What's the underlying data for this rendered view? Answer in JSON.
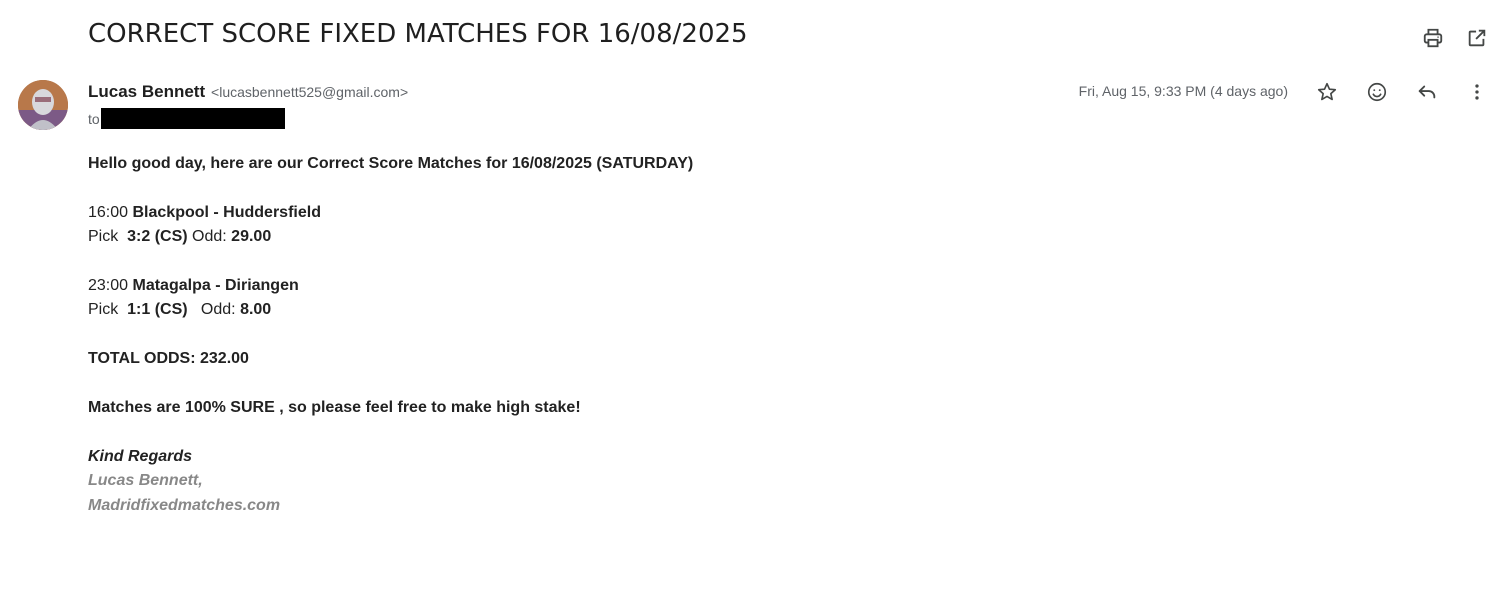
{
  "subject": "CORRECT SCORE FIXED MATCHES FOR 16/08/2025",
  "sender": {
    "name": "Lucas Bennett",
    "email": "<lucasbennett525@gmail.com>"
  },
  "to_label": "to",
  "date": "Fri, Aug 15, 9:33 PM (4 days ago)",
  "icons": {
    "print": "printer-icon",
    "open_new": "open-in-new-window-icon",
    "star": "star-icon",
    "emoji": "emoji-reaction-icon",
    "reply": "reply-icon",
    "more": "more-vert-icon"
  },
  "body": {
    "greeting": "Hello good day, here are our Correct Score Matches for 16/08/2025 (SATURDAY)",
    "match1": {
      "time": "16:00",
      "teams": "Blackpool - Huddersfield",
      "pick_label": "Pick",
      "pick": "3:2 (CS)",
      "odd_label": "Odd:",
      "odd": "29.00"
    },
    "match2": {
      "time": "23:00",
      "teams": "Matagalpa - Diriangen",
      "pick_label": "Pick",
      "pick": "1:1 (CS)",
      "odd_label": "Odd:",
      "odd": "8.00"
    },
    "total": "TOTAL ODDS: 232.00",
    "note": "Matches are 100% SURE , so please feel free to make high stake!",
    "regards": "Kind Regards",
    "sig_name": "Lucas Bennett,",
    "sig_site": "Madridfixedmatches.com"
  },
  "colors": {
    "text": "#222222",
    "muted": "#5f6368",
    "signature": "#888888"
  }
}
